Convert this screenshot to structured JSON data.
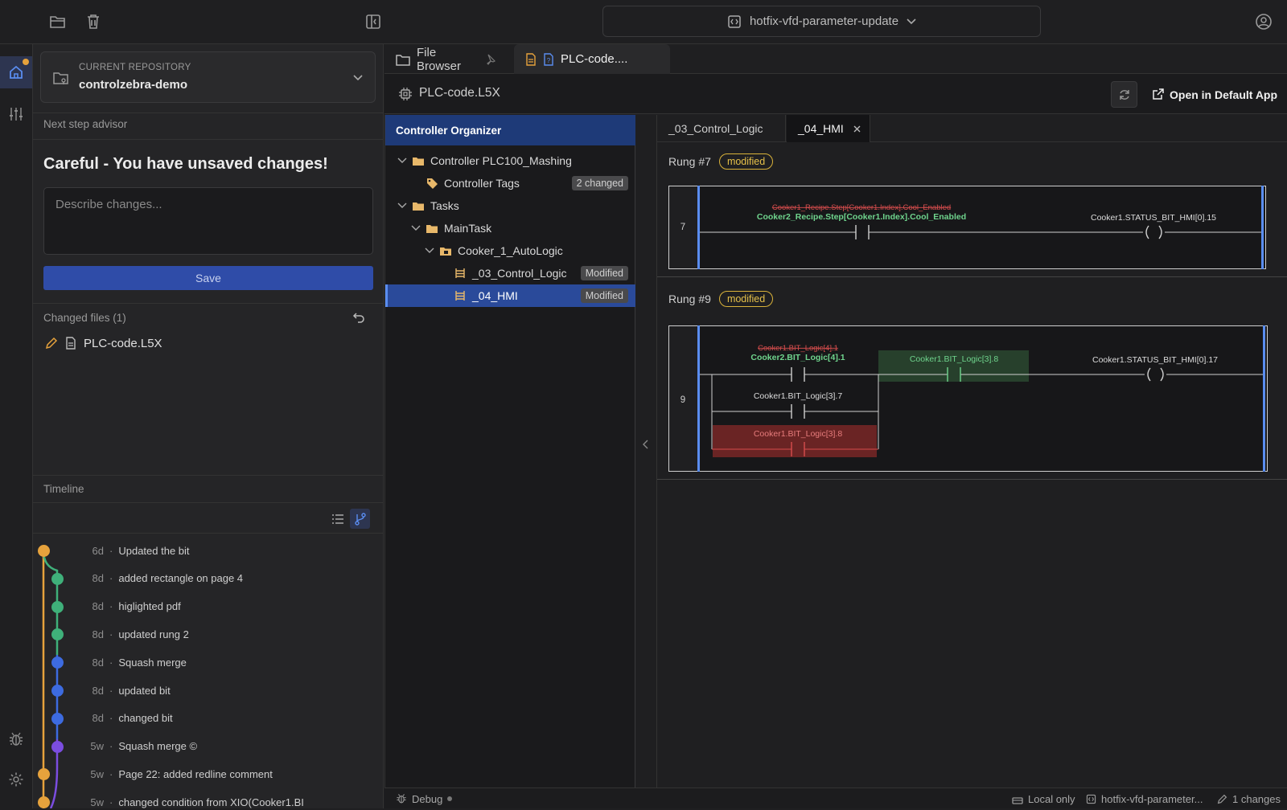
{
  "topbar": {
    "branch_name": "hotfix-vfd-parameter-update"
  },
  "repo": {
    "caption": "CURRENT REPOSITORY",
    "name": "controlzebra-demo"
  },
  "advisor": {
    "title": "Next step advisor",
    "heading": "Careful - You have unsaved changes!",
    "placeholder": "Describe changes...",
    "save_label": "Save"
  },
  "changed_files": {
    "title": "Changed files (1)",
    "items": [
      {
        "name": "PLC-code.L5X"
      }
    ]
  },
  "timeline": {
    "title": "Timeline",
    "items": [
      {
        "age": "6d",
        "msg": "Updated the bit",
        "color": "#e6a23c"
      },
      {
        "age": "8d",
        "msg": "added rectangle on page 4",
        "color": "#3fb07a"
      },
      {
        "age": "8d",
        "msg": "higlighted pdf",
        "color": "#3fb07a"
      },
      {
        "age": "8d",
        "msg": "updated rung 2",
        "color": "#3fb07a"
      },
      {
        "age": "8d",
        "msg": "Squash merge",
        "color": "#3d6be0"
      },
      {
        "age": "8d",
        "msg": "updated bit",
        "color": "#3d6be0"
      },
      {
        "age": "8d",
        "msg": "changed bit",
        "color": "#3d6be0"
      },
      {
        "age": "5w",
        "msg": "Squash merge ©",
        "color": "#7b4de0"
      },
      {
        "age": "5w",
        "msg": "Page 22: added redline comment",
        "color": "#e6a23c"
      },
      {
        "age": "5w",
        "msg": "changed condition from XIO(Cooker1.BI",
        "color": "#e6a23c"
      }
    ]
  },
  "tabs": {
    "file_browser": "File Browser",
    "plc_tab": "PLC-code...."
  },
  "file_header": {
    "filename": "PLC-code.L5X",
    "open_label": "Open in Default App"
  },
  "organizer": {
    "header": "Controller Organizer",
    "controller": "Controller PLC100_Mashing",
    "tags": "Controller Tags",
    "tags_badge": "2 changed",
    "tasks": "Tasks",
    "maintask": "MainTask",
    "program": "Cooker_1_AutoLogic",
    "routine1": "_03_Control_Logic",
    "routine1_badge": "Modified",
    "routine2": "_04_HMI",
    "routine2_badge": "Modified"
  },
  "routine_tabs": {
    "tab1": "_03_Control_Logic",
    "tab2": "_04_HMI"
  },
  "rungs": {
    "r7_label": "Rung",
    "r7_num": "#7",
    "r7_badge": "modified",
    "r7_index": "7",
    "r7_old_tag": "Cooker1_Recipe.Step[Cooker1.Index].Cool_Enabled",
    "r7_new_tag": "Cooker2_Recipe.Step[Cooker1.Index].Cool_Enabled",
    "r7_coil": "Cooker1.STATUS_BIT_HMI[0].15",
    "r9_label": "Rung",
    "r9_num": "#9",
    "r9_badge": "modified",
    "r9_index": "9",
    "r9_old_tag": "Cooker1.BIT_Logic[4].1",
    "r9_new_tag": "Cooker2.BIT_Logic[4].1",
    "r9_added_tag": "Cooker1.BIT_Logic[3].8",
    "r9_branch_tag": "Cooker1.BIT_Logic[3].7",
    "r9_removed_tag": "Cooker1.BIT_Logic[3].8",
    "r9_coil": "Cooker1.STATUS_BIT_HMI[0].17"
  },
  "statusbar": {
    "debug": "Debug",
    "local": "Local only",
    "branch": "hotfix-vfd-parameter...",
    "changes": "1 changes"
  }
}
